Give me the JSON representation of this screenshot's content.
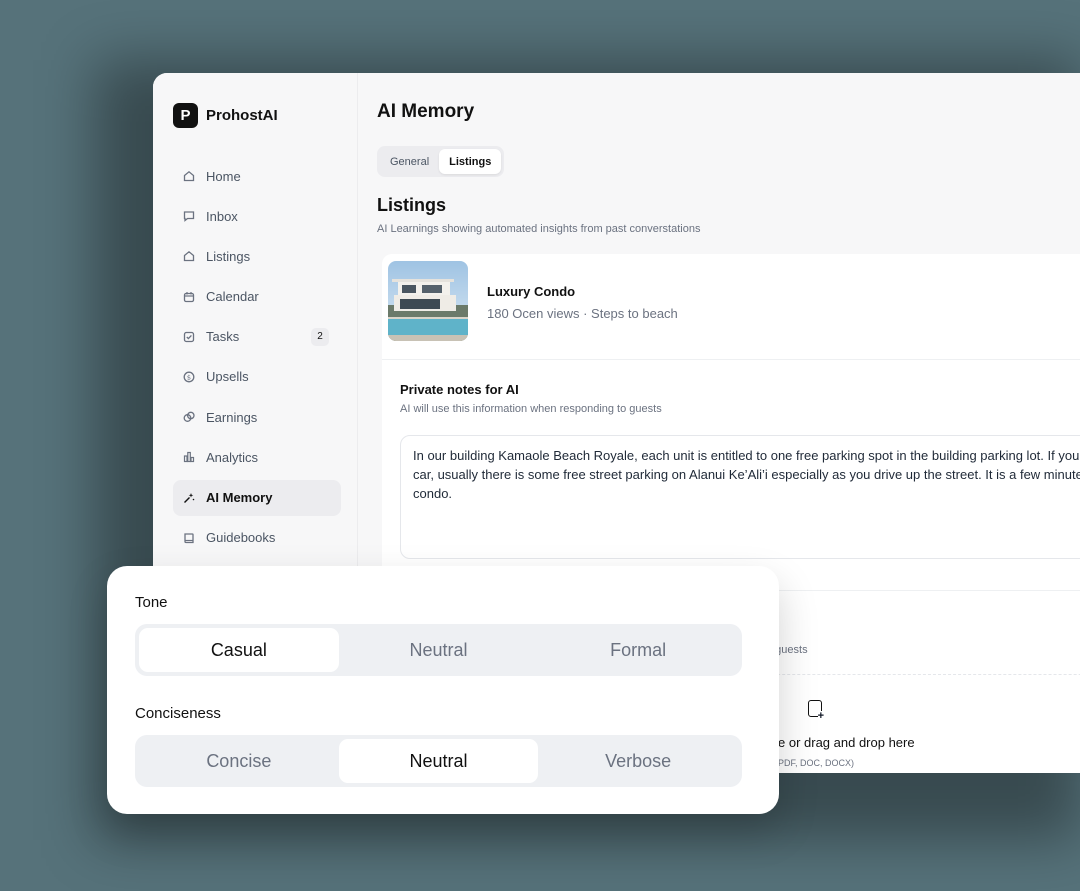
{
  "app": {
    "name": "ProhostAI",
    "logo_letter": "P"
  },
  "sidebar": {
    "items": [
      {
        "label": "Home",
        "icon": "home-icon"
      },
      {
        "label": "Inbox",
        "icon": "message-icon"
      },
      {
        "label": "Listings",
        "icon": "home-icon"
      },
      {
        "label": "Calendar",
        "icon": "calendar-icon"
      },
      {
        "label": "Tasks",
        "icon": "checkbox-icon",
        "badge": "2"
      },
      {
        "label": "Upsells",
        "icon": "dollar-icon"
      },
      {
        "label": "Earnings",
        "icon": "coins-icon"
      },
      {
        "label": "Analytics",
        "icon": "bar-chart-icon"
      },
      {
        "label": "AI Memory",
        "icon": "sparkle-icon",
        "active": true
      },
      {
        "label": "Guidebooks",
        "icon": "book-icon"
      }
    ]
  },
  "main": {
    "title": "AI Memory",
    "tabs": [
      {
        "label": "General"
      },
      {
        "label": "Listings",
        "active": true
      }
    ],
    "section_title": "Listings",
    "section_subtitle": "AI Learnings showing automated insights from past converstations",
    "listing": {
      "name": "Luxury Condo",
      "description": "180 Ocen views · Steps to beach"
    },
    "notes": {
      "title": "Private notes for AI",
      "subtitle": "AI will use this information when responding to guests",
      "lines": [
        "In our building Kamaole Beach Royale, each unit is entitled to one free parking spot in the building parking lot. If you",
        "car, usually there is some free street parking on Alanui Ke’Ali’i especially as you drive up the street. It is a few minute",
        "condo."
      ]
    },
    "partial_subtitle": "o guests",
    "upload": {
      "text": "e or drag and drop here",
      "hint": "PDF, DOC, DOCX)"
    }
  },
  "overlay": {
    "tone_label": "Tone",
    "tone_options": [
      "Casual",
      "Neutral",
      "Formal"
    ],
    "tone_selected": "Casual",
    "conciseness_label": "Conciseness",
    "conciseness_options": [
      "Concise",
      "Neutral",
      "Verbose"
    ],
    "conciseness_selected": "Neutral"
  },
  "colors": {
    "backdrop": "#56727a",
    "app_bg": "#f7f7f8",
    "active_nav": "#ececef",
    "segment_bg": "#eef0f3"
  }
}
